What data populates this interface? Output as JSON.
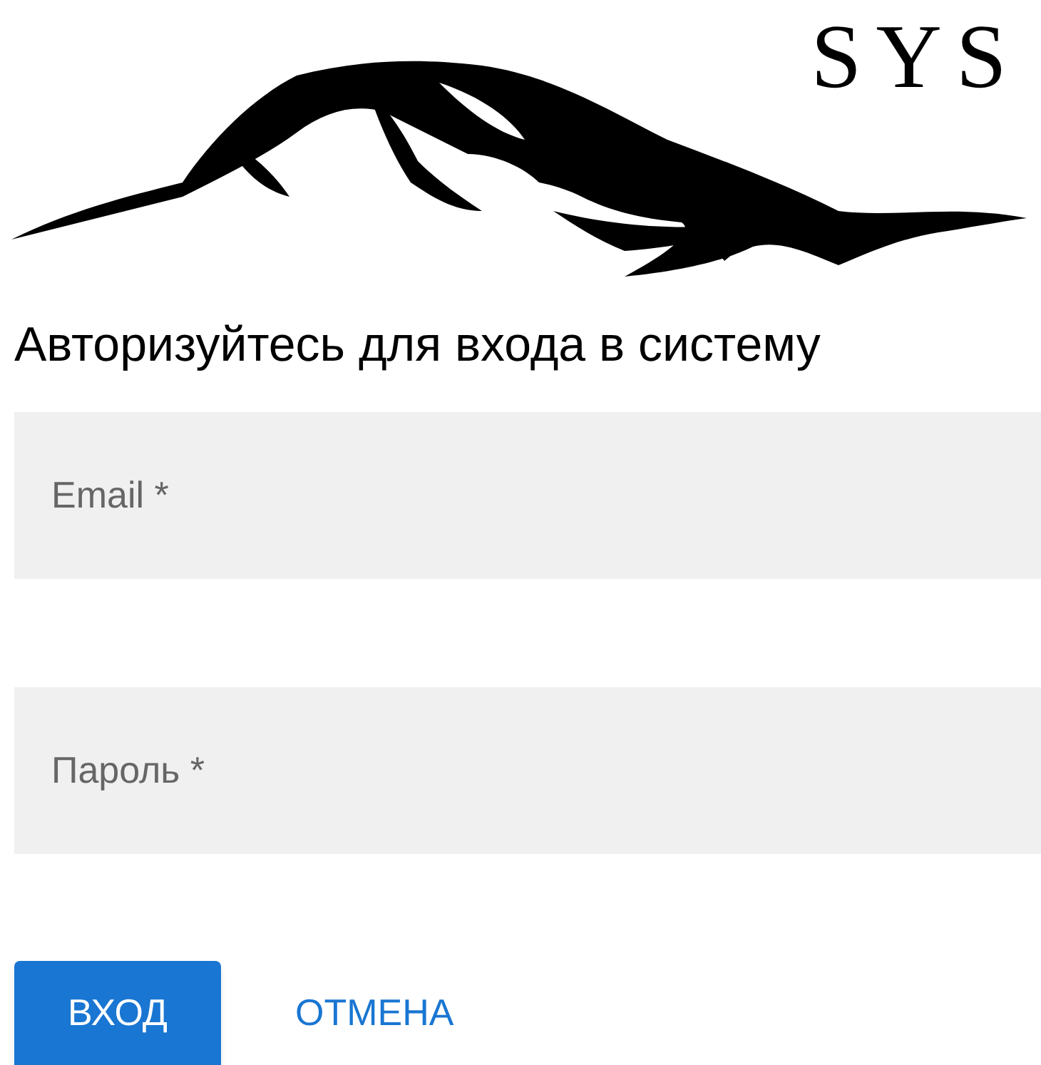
{
  "logo": {
    "text": "SYS"
  },
  "heading": "Авторизуйтесь для входа в систему",
  "fields": [
    {
      "placeholder": "Email *"
    },
    {
      "placeholder": "Пароль *"
    }
  ],
  "buttons": [
    {
      "kind": "primary",
      "label": "ВХОД"
    },
    {
      "kind": "text",
      "label": "ОТМЕНА"
    }
  ]
}
